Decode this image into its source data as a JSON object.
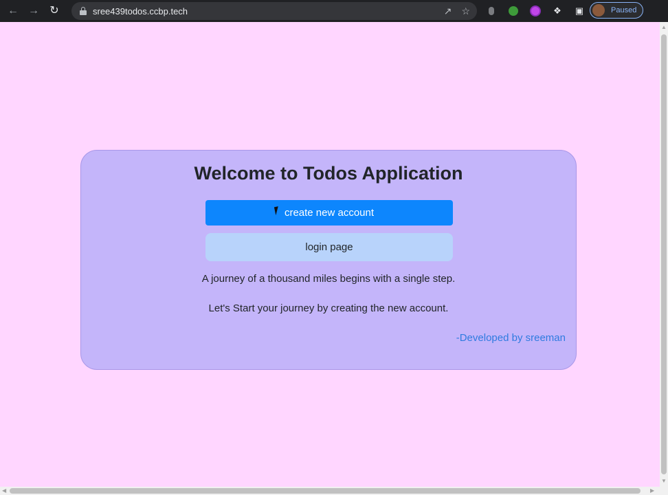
{
  "browser": {
    "url": "sree439todos.ccbp.tech",
    "profile_status": "Paused",
    "icons": {
      "back": "arrow-left-icon",
      "forward": "arrow-right-icon",
      "reload": "reload-icon",
      "lock": "lock-icon",
      "share": "share-icon",
      "bookmark": "star-icon",
      "extensions": "puzzle-icon",
      "sidepanel": "side-panel-icon"
    }
  },
  "card": {
    "title": "Welcome to Todos Application",
    "create_account_label": "create new account",
    "login_label": "login page",
    "quote": "A journey of a thousand miles begins with a single step.",
    "subtext": "Let's Start your journey by creating the new account.",
    "developer": "-Developed by sreeman"
  },
  "colors": {
    "page_bg": "#ffd6ff",
    "card_bg": "#c4b5fa",
    "primary_button": "#0d86fd",
    "secondary_button": "#b8d3fb",
    "developer_text": "#2f7be0"
  }
}
